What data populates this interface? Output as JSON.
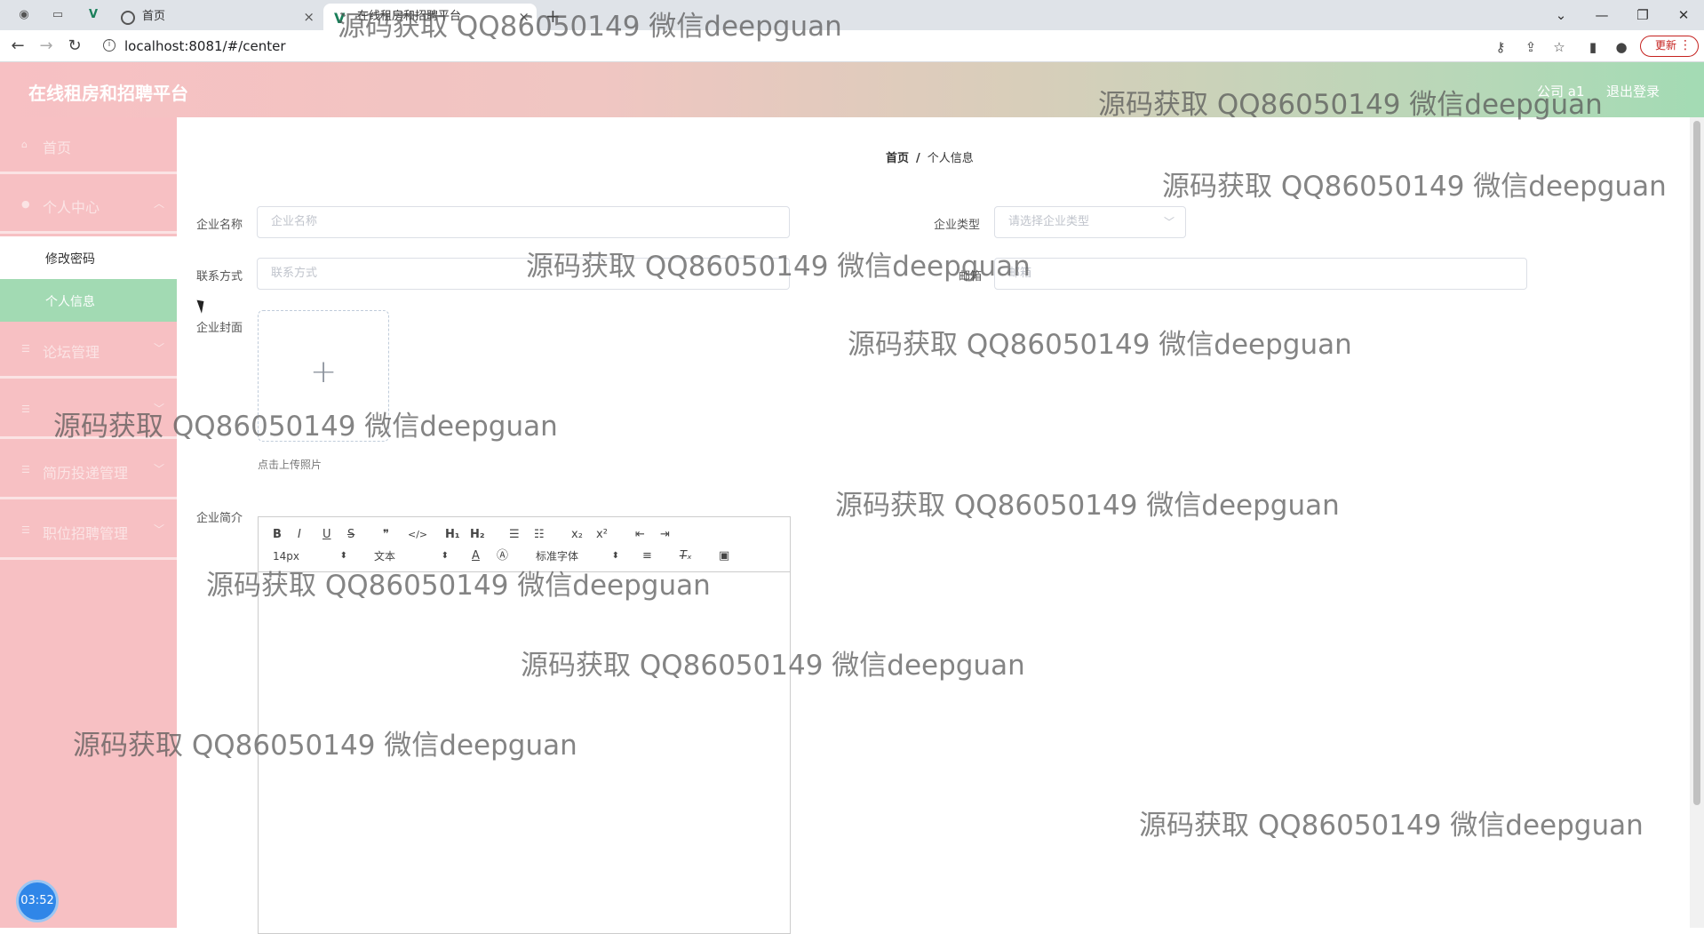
{
  "browser": {
    "tabs": [
      {
        "title": "首页"
      },
      {
        "title": "在线租房和招聘平台"
      }
    ],
    "new_tab": "+",
    "url": "localhost:8081/#/center",
    "update_label": "更新"
  },
  "app": {
    "title": "在线租房和招聘平台",
    "user_label": "公司 a1",
    "logout_label": "退出登录"
  },
  "sidebar": {
    "items": [
      {
        "label": "首页"
      },
      {
        "label": "个人中心"
      },
      {
        "label": "论坛管理"
      },
      {
        "label": "简历投递管理"
      },
      {
        "label": "职位招聘管理"
      }
    ],
    "sub_items": [
      {
        "label": "修改密码"
      },
      {
        "label": "个人信息"
      }
    ]
  },
  "breadcrumb": {
    "home": "首页",
    "separator": "/",
    "current": "个人信息"
  },
  "form": {
    "company_name": {
      "label": "企业名称",
      "placeholder": "企业名称"
    },
    "company_type": {
      "label": "企业类型",
      "placeholder": "请选择企业类型"
    },
    "contact": {
      "label": "联系方式",
      "placeholder": "联系方式"
    },
    "email": {
      "label": "邮箱",
      "placeholder": "邮箱"
    },
    "cover": {
      "label": "企业封面",
      "tip": "点击上传照片"
    },
    "intro": {
      "label": "企业简介"
    }
  },
  "editor": {
    "font_size": "14px",
    "heading": "文本",
    "font_family": "标准字体",
    "buttons": [
      "B",
      "I",
      "U",
      "S",
      "❞",
      "</>",
      "H₁",
      "H₂",
      "☰",
      "☷",
      "x₂",
      "x²"
    ]
  },
  "watermark": "源码获取 QQ86050149 微信deepguan",
  "timer": "03:52"
}
